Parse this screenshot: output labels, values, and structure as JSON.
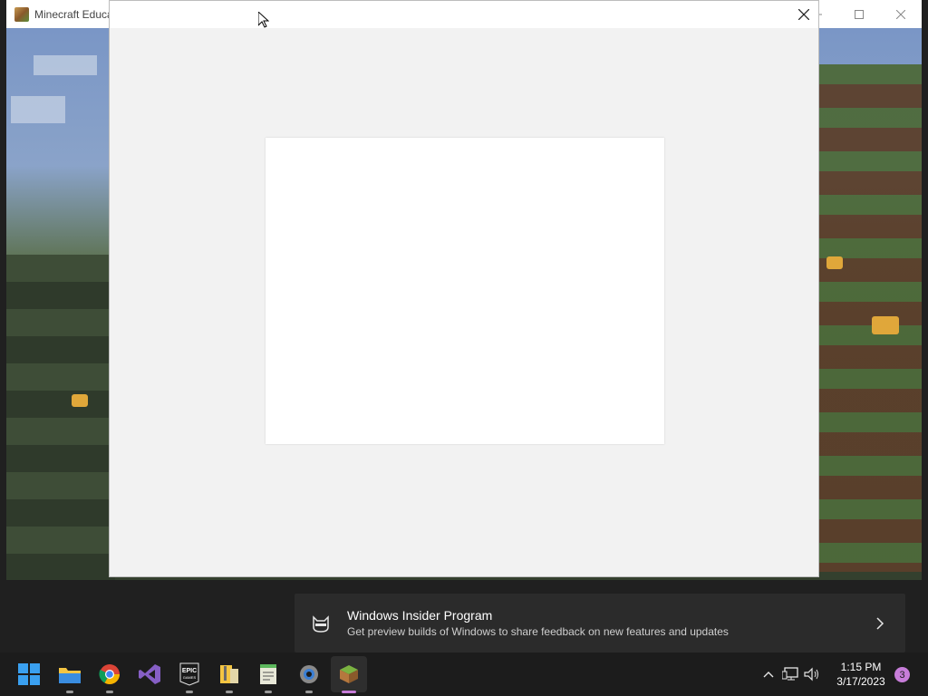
{
  "background_window": {
    "title": "Minecraft Educa",
    "controls": [
      "minimize",
      "maximize",
      "close"
    ]
  },
  "dialog": {
    "close_glyph": "✕"
  },
  "toast": {
    "title": "Windows Insider Program",
    "body": "Get preview builds of Windows to share feedback on new features and updates",
    "chevron": "›"
  },
  "taskbar": {
    "apps": [
      {
        "name": "start-button",
        "icon": "windows-logo"
      },
      {
        "name": "file-explorer",
        "icon": "folder-icon"
      },
      {
        "name": "chrome",
        "icon": "chrome-icon"
      },
      {
        "name": "visual-studio",
        "icon": "visual-studio-icon"
      },
      {
        "name": "epic-games",
        "icon": "epic-games-icon",
        "label": "EPIC\nGAMES"
      },
      {
        "name": "archive-app",
        "icon": "zip-folder-icon"
      },
      {
        "name": "notepad",
        "icon": "notepad-icon"
      },
      {
        "name": "settings",
        "icon": "gear-icon"
      },
      {
        "name": "minecraft",
        "icon": "minecraft-icon"
      }
    ],
    "time": "1:15 PM",
    "date": "3/17/2023",
    "notification_count": "3"
  },
  "colors": {
    "accent": "#c77dd9",
    "taskbar": "#1c1c1c",
    "dialog_bg": "#f2f2f2"
  }
}
